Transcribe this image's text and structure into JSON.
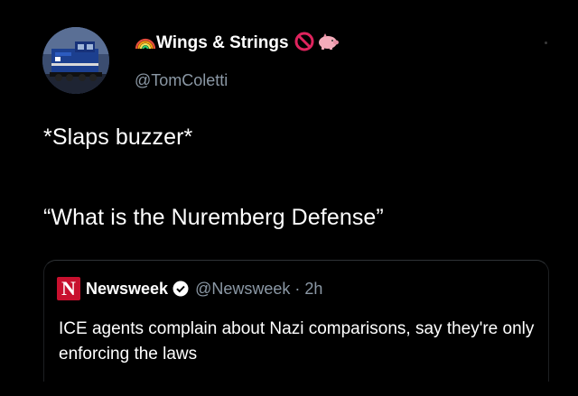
{
  "tweet": {
    "author": {
      "display_name": "Wings & Strings",
      "handle": "@TomColetti",
      "name_emojis": [
        "rainbow-icon",
        "no-entry-icon",
        "pig-icon"
      ],
      "avatar": "locomotive-avatar"
    },
    "text_line_1": "*Slaps buzzer*",
    "text_line_2": "“What is the Nuremberg Defense”"
  },
  "quoted_tweet": {
    "logo_letter": "N",
    "name": "Newsweek",
    "verified": true,
    "handle": "@Newsweek",
    "separator": "·",
    "time": "2h",
    "text": "ICE agents complain about Nazi comparisons, say they're only enforcing the laws"
  },
  "colors": {
    "background": "#000000",
    "text": "#ffffff",
    "secondary_text": "#8b98a5",
    "newsweek_red": "#c8102e",
    "no_entry_red": "#e0245e",
    "pig_pink": "#f4abba"
  }
}
